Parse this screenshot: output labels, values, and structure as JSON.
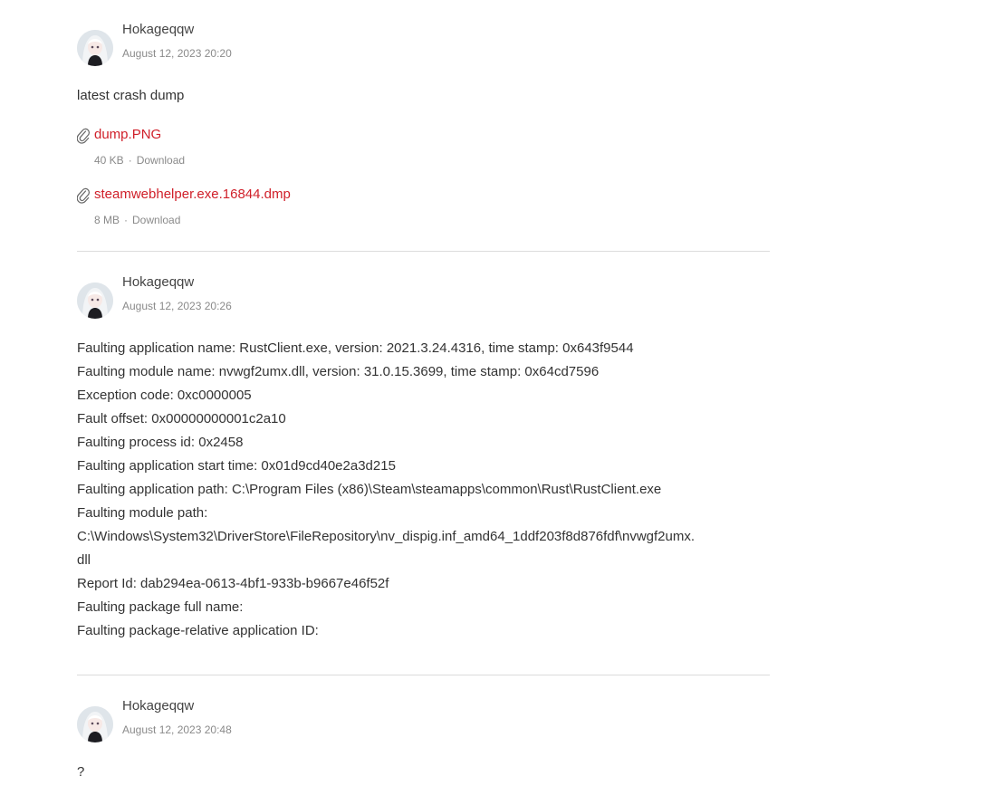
{
  "comments": [
    {
      "author": "Hokageqqw",
      "date": "August 12, 2023 20:20",
      "text": "latest crash dump",
      "attachments": [
        {
          "name": "dump.PNG",
          "size": "40 KB",
          "action": "Download"
        },
        {
          "name": "steamwebhelper.exe.16844.dmp",
          "size": "8 MB",
          "action": "Download"
        }
      ]
    },
    {
      "author": "Hokageqqw",
      "date": "August 12, 2023 20:26",
      "lines": [
        "Faulting application name: RustClient.exe, version: 2021.3.24.4316, time stamp: 0x643f9544",
        "Faulting module name: nvwgf2umx.dll, version: 31.0.15.3699, time stamp: 0x64cd7596",
        "Exception code: 0xc0000005",
        "Fault offset: 0x00000000001c2a10",
        "Faulting process id: 0x2458",
        "Faulting application start time: 0x01d9cd40e2a3d215",
        "Faulting application path: C:\\Program Files (x86)\\Steam\\steamapps\\common\\Rust\\RustClient.exe",
        "Faulting module path:",
        "C:\\Windows\\System32\\DriverStore\\FileRepository\\nv_dispig.inf_amd64_1ddf203f8d876fdf\\nvwgf2umx.",
        "dll",
        "Report Id: dab294ea-0613-4bf1-933b-b9667e46f52f",
        "Faulting package full name:",
        "Faulting package-relative application ID:"
      ]
    },
    {
      "author": "Hokageqqw",
      "date": "August 12, 2023 20:48",
      "text": "?"
    }
  ],
  "icons": {
    "attachment": "paperclip-icon",
    "avatar": "user-avatar"
  },
  "colors": {
    "link": "#d0202a",
    "muted": "#8a8a8a",
    "divider": "#dcdcdc"
  }
}
